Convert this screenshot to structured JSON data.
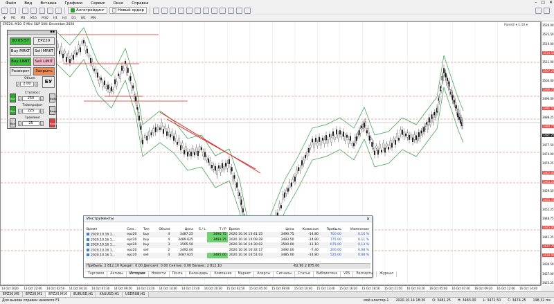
{
  "menu": [
    "Файл",
    "Вид",
    "Вставка",
    "Графики",
    "Сервис",
    "Окно",
    "Справка"
  ],
  "toolbar": {
    "algo_label": "Алготрейдинг",
    "new_order_label": "Новый ордер"
  },
  "timeframes": [
    "M1",
    "M5",
    "M15",
    "M30",
    "H1",
    "H4",
    "D1",
    "W1",
    "MN"
  ],
  "chart": {
    "title": "EPZ20, M10: E-Mini S&P 500: December 2020",
    "right_tag": "Panel2 ▾ 1.10 ▾",
    "price_labels": [
      {
        "v": "3526.00",
        "t": "norm"
      },
      {
        "v": "3522.50",
        "t": "norm"
      },
      {
        "v": "3519.00",
        "t": "norm"
      },
      {
        "v": "3514.50",
        "t": "red"
      },
      {
        "v": "3511.00",
        "t": "norm"
      },
      {
        "v": "3507.25",
        "t": "red"
      },
      {
        "v": "3504.00",
        "t": "norm"
      },
      {
        "v": "3499.75",
        "t": "red"
      },
      {
        "v": "3496.00",
        "t": "norm"
      },
      {
        "v": "3491.50",
        "t": "red"
      },
      {
        "v": "3488.25",
        "t": "norm"
      },
      {
        "v": "3484.75",
        "t": "red"
      },
      {
        "v": "3481.25",
        "t": "dark"
      },
      {
        "v": "3477.50",
        "t": "norm"
      },
      {
        "v": "3474.00",
        "t": "norm"
      },
      {
        "v": "3470.25",
        "t": "norm"
      },
      {
        "v": "3467.00",
        "t": "red"
      },
      {
        "v": "3463.25",
        "t": "red"
      },
      {
        "v": "3459.50",
        "t": "norm"
      },
      {
        "v": "3455.75",
        "t": "red"
      },
      {
        "v": "3452.25",
        "t": "norm"
      },
      {
        "v": "3448.75",
        "t": "norm"
      },
      {
        "v": "3445.00",
        "t": "red"
      },
      {
        "v": "3441.25",
        "t": "norm"
      },
      {
        "v": "3437.75",
        "t": "red"
      },
      {
        "v": "3434.00",
        "t": "red"
      },
      {
        "v": "3430.50",
        "t": "norm"
      },
      {
        "v": "3427.00",
        "t": "norm"
      },
      {
        "v": "3423.25",
        "t": "norm"
      }
    ],
    "time_labels": [
      "13 Oct 2020",
      "13 Oct 22:00",
      "14 Oct 02:50",
      "14 Oct 04:10",
      "14 Oct 07:30",
      "14 Oct 09:50",
      "14 Oct 12:20",
      "14 Oct 14:40",
      "14 Oct 17:40",
      "14 Oct 20:30",
      "15 Oct 02:50",
      "15 Oct 05:50",
      "15 Oct 08:00",
      "15 Oct 10:40",
      "15 Oct 13:40",
      "15 Oct 16:20",
      "15 Oct 18:50",
      "15 Oct 21:50",
      "16 Oct 03:20",
      "16 Oct 05:00",
      "16 Oct 07:40",
      "16 Oct 09:20",
      "16 Oct 12:00",
      "16 Oct 14:40"
    ]
  },
  "otp": {
    "time": "00:05:57",
    "symbol": "EPZ20",
    "buy_mrkt": "Buy MRKT",
    "sell_mrkt": "Sell MRKT",
    "buy_limit": "Buy LIMIT",
    "sell_limit": "Sell LIMIT",
    "reverse": "Разворот",
    "close": "Закрыть",
    "volume_label": "Объем",
    "volume": "2.00",
    "bu": "БУ",
    "on": "Вкл",
    "off": "Выкл",
    "stoploss_label": "Стоплосс",
    "stoploss": "250",
    "takeprofit_label": "Тейкпрофит",
    "takeprofit": "225",
    "trailing_label": "Трейлинг",
    "trailing": "25"
  },
  "instruments": {
    "title": "Инструменты",
    "headers": [
      "Время",
      "Сим...",
      "Тип",
      "Объем",
      "Цена",
      "S / L",
      "T / P",
      "Время",
      "Цена",
      "Комиссия",
      "Прибыль",
      "Изменение"
    ],
    "rows": [
      [
        "2020.10.16 1...",
        "epz20",
        "buy",
        "4",
        "3487.25",
        "",
        "3490.75",
        "2020.10.16 13:41:25",
        "3490.75",
        "-14.80",
        "700.00",
        "0.10 %"
      ],
      [
        "2020.10.16 1...",
        "epz20",
        "buy",
        "4",
        "3489.625",
        "",
        "3493.25",
        "2020.10.16 14:09:28",
        "3493.50",
        "-14.80",
        "775.00",
        "0.11 %"
      ],
      [
        "2020.10.16 1...",
        "epz20",
        "buy",
        "3",
        "3505.50",
        "",
        "",
        "2020.10.16 14:30:02",
        "3500.00",
        "-11.10",
        "675.00",
        "0.13 %"
      ],
      [
        "2020.10.16 1...",
        "epz20",
        "sell",
        "2",
        "3492.00",
        "",
        "",
        "2020.10.16 16:32:17",
        "3492.00",
        "-7.40",
        "200.00",
        "0.08 %"
      ],
      [
        "2020.10.16 1...",
        "epz20",
        "sell",
        "4",
        "3487.625",
        "",
        "3485.00",
        "2020.10.16 16:51:03",
        "3485.00",
        "-14.80",
        "525.00",
        "0.08 %"
      ]
    ],
    "tp_rows": [
      0,
      1,
      4
    ],
    "summary": "Прибыль: 2 812.10  Кредит: 0.00  Депозит: 0.00  Снятие: 0.00  Баланс: 2 812.10",
    "summary_right": "-62.90      2 875.00",
    "tabs": [
      "Торговля",
      "Активы",
      "История",
      "Новости",
      "Почта",
      "Календарь",
      "Компания",
      "Маркет",
      "Алерты",
      "Сигналы",
      "Статьи",
      "Библиотека",
      "VPS",
      "Эксперты",
      "Журнал"
    ],
    "active_tab": 2
  },
  "chart_tabs": [
    "EPZ20,M5",
    "EPZ20,M1",
    "EPZ20,M10",
    "EURUSD,H1",
    "XAUUSD,H1",
    "USDRUB,H1"
  ],
  "active_chart_tab": 2,
  "status": {
    "help": "Для вызова справки нажмите F1",
    "profile": "мой кластер-1",
    "time": "2020.10.14 18:30",
    "o": "O: 3481.25",
    "h": "H: 3483.00",
    "l": "L: 3472.50",
    "c": "C: 3474.25",
    "kb": "198.32 ms"
  }
}
